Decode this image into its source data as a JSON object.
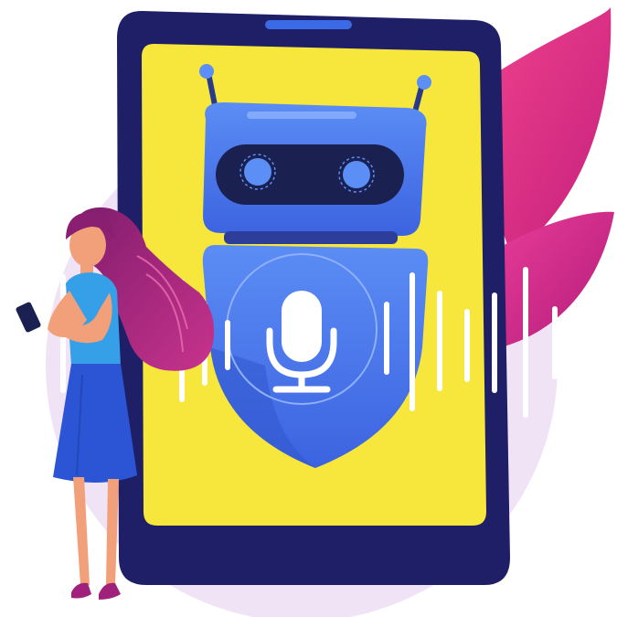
{
  "illustration": {
    "subject": "voice-assistant-illustration",
    "icons": [
      "robot-icon",
      "microphone-icon",
      "smartphone-icon"
    ],
    "colors": {
      "background": "#ffffff",
      "backdrop_circle": "#f1e3f6",
      "tablet_frame": "#1f1f67",
      "tablet_screen": "#f7e63c",
      "robot_blue": "#4f7cf0",
      "robot_dark": "#1a2050",
      "robot_eye": "#5b8ff5",
      "leaf_pink": "#e0328b",
      "leaf_magenta": "#c42480",
      "waveform_white": "#ffffff",
      "hair": "#a0217b",
      "skin": "#f1a07a",
      "shirt": "#35a0e7",
      "skirt": "#2c55d6",
      "shoes": "#a0217b"
    }
  }
}
